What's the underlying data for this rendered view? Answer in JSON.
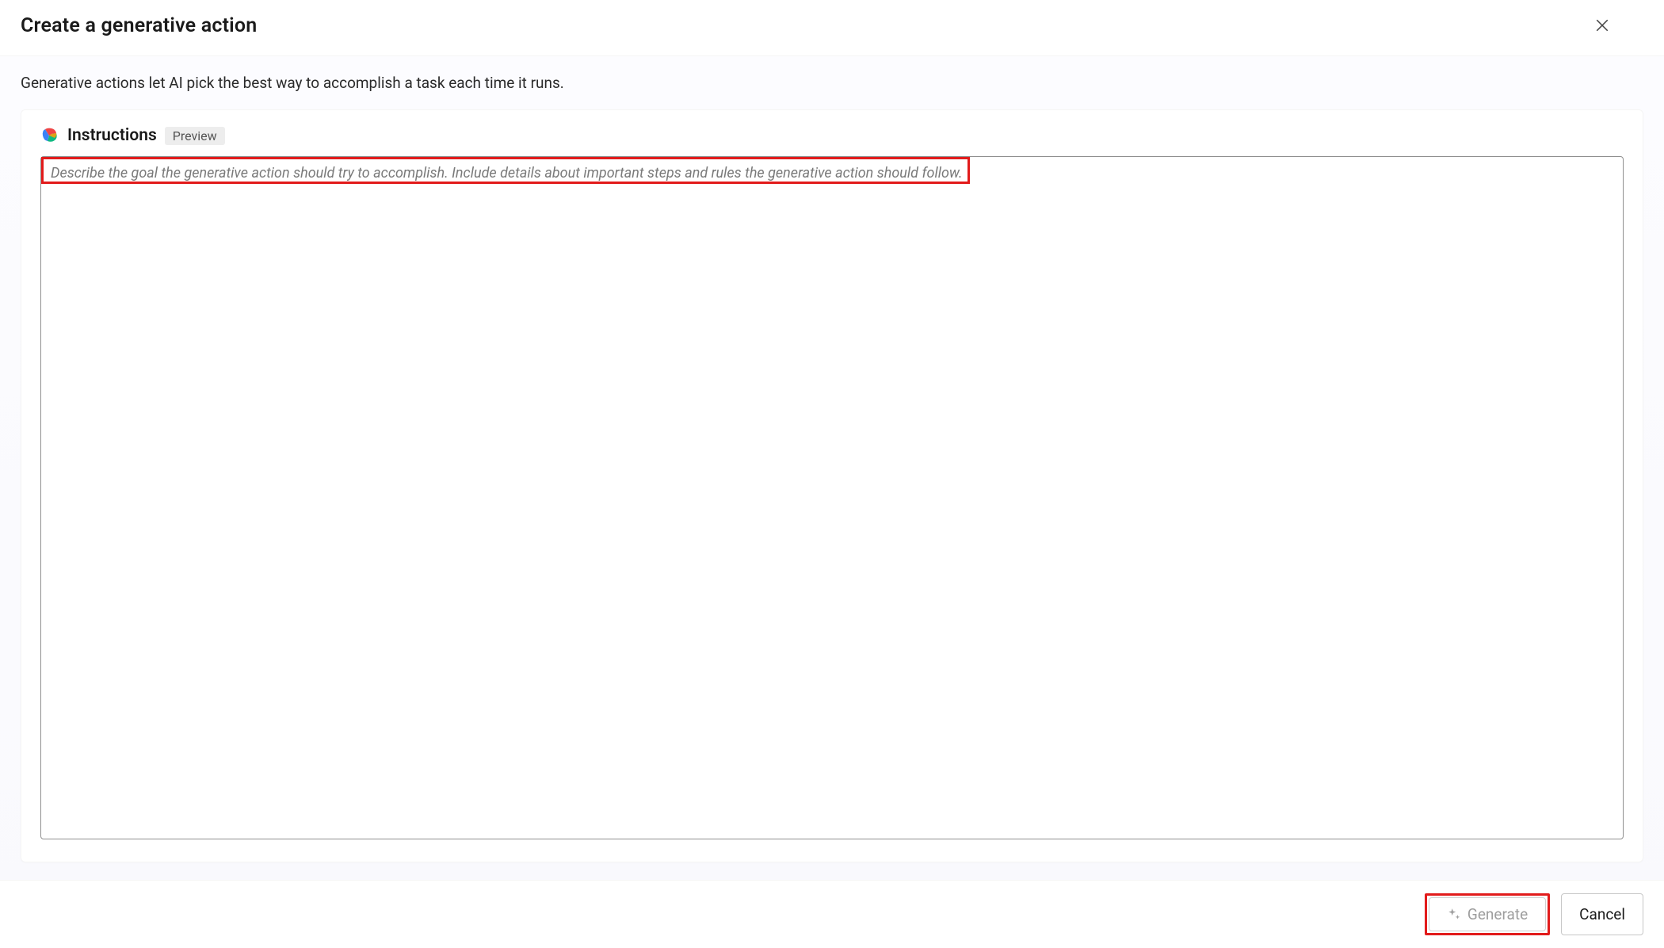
{
  "dialog": {
    "title": "Create a generative action",
    "subtext": "Generative actions let AI pick the best way to accomplish a task each time it runs."
  },
  "instructions": {
    "title": "Instructions",
    "badge": "Preview",
    "placeholder": "Describe the goal the generative action should try to accomplish. Include details about important steps and rules the generative action should follow.",
    "value": ""
  },
  "footer": {
    "generate_label": "Generate",
    "cancel_label": "Cancel"
  }
}
